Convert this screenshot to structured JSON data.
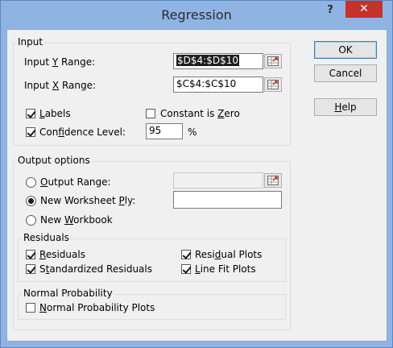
{
  "window": {
    "title": "Regression",
    "help_glyph": "?",
    "close_glyph": "✕"
  },
  "buttons": {
    "ok": "OK",
    "cancel": "Cancel",
    "help_pre": "",
    "help_u": "H",
    "help_post": "elp"
  },
  "input": {
    "legend": "Input",
    "y_range": {
      "pre": "Input ",
      "u": "Y",
      "post": " Range:",
      "value": "$D$4:$D$10",
      "selected": true
    },
    "x_range": {
      "pre": "Input ",
      "u": "X",
      "post": " Range:",
      "value": "$C$4:$C$10"
    },
    "labels": {
      "pre": "",
      "u": "L",
      "post": "abels",
      "checked": true
    },
    "constant_zero": {
      "pre": "Constant is ",
      "u": "Z",
      "post": "ero",
      "checked": false
    },
    "confidence": {
      "pre": "Con",
      "u": "f",
      "post": "idence Level:",
      "checked": true,
      "value": "95",
      "unit": "%"
    }
  },
  "output": {
    "legend": "Output options",
    "output_range": {
      "pre": "",
      "u": "O",
      "post": "utput Range:",
      "selected": false,
      "value": ""
    },
    "new_ply": {
      "pre": "New Worksheet ",
      "u": "P",
      "post": "ly:",
      "selected": true,
      "value": ""
    },
    "new_workbook": {
      "pre": "New ",
      "u": "W",
      "post": "orkbook",
      "selected": false
    }
  },
  "residuals": {
    "legend": "Residuals",
    "residuals": {
      "pre": "",
      "u": "R",
      "post": "esiduals",
      "checked": true
    },
    "standardized": {
      "pre": "S",
      "u": "t",
      "post": "andardized Residuals",
      "checked": true
    },
    "residual_plots": {
      "pre": "Resi",
      "u": "d",
      "post": "ual Plots",
      "checked": true
    },
    "line_fit": {
      "pre": "",
      "u": "L",
      "post": "ine Fit Plots",
      "checked": true
    }
  },
  "normal_probability": {
    "legend": "Normal Probability",
    "plots": {
      "pre": "",
      "u": "N",
      "post": "ormal Probability Plots",
      "checked": false
    }
  },
  "colors": {
    "frame": "#8fb4e3",
    "client": "#f0f0f0",
    "close": "#c7302b",
    "selection": "#1e1e1e"
  },
  "icons": {
    "range_picker": "range-picker-icon",
    "check": "checkmark-icon",
    "radio": "radio-dot-icon"
  }
}
